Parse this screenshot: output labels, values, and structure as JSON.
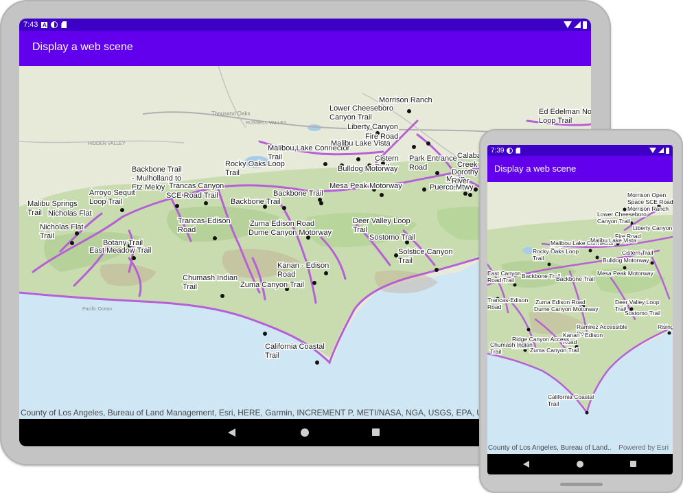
{
  "tablet": {
    "status": {
      "time": "7:43"
    },
    "app_title": "Display a web scene",
    "attribution": "County of Los Angeles, Bureau of Land Management, Esri, HERE, Garmin, INCREMENT P, METI/NASA, NGA, USGS, EPA, USDA",
    "trail_labels": [
      [
        "Morrison Ranch"
      ],
      [
        "Lower Cheeseboro",
        "Canyon Trail"
      ],
      [
        "Liberty Canyon"
      ],
      [
        "Fire Road"
      ],
      [
        "Malibou Lake Connector",
        "Trail"
      ],
      [
        "Malibu Lake Vista"
      ],
      [
        "Cistern",
        "Trail"
      ],
      [
        "Park Entrance",
        "Road"
      ],
      [
        "Bulldog Motorway"
      ],
      [
        "Ed Edelman No",
        "Loop Trail"
      ],
      [
        "Rocky Oaks Loop",
        "Trail"
      ],
      [
        "Backbone Trail",
        "- Mulholland to",
        "Etz Meloy"
      ],
      [
        "Trancas Canyon"
      ],
      [
        "SCE Road Trail"
      ],
      [
        "Arroyo Sequit",
        "Loop Trail"
      ],
      [
        "Backbone Trail"
      ],
      [
        "Backbone Trail"
      ],
      [
        "Mesa Peak Motorway"
      ],
      [
        "Malibu Springs",
        "Trail"
      ],
      [
        "Nicholas Flat"
      ],
      [
        "Nicholas Flat",
        "Trail"
      ],
      [
        "Trancas-Edison",
        "Road"
      ],
      [
        "Zuma Edison Road"
      ],
      [
        "Dume Canyon Motorway"
      ],
      [
        "Deer Valley Loop",
        "Trail"
      ],
      [
        "Sostomo Trail"
      ],
      [
        "Botany Trail"
      ],
      [
        "East Meadow Trail"
      ],
      [
        "Solstice Canyon",
        "Trail"
      ],
      [
        "Kanan - Edison",
        "Road"
      ],
      [
        "Chumash Indian",
        "Trail"
      ],
      [
        "Zuma Canyon Trail"
      ],
      [
        "California Coastal",
        "Trail"
      ],
      [
        "Calaba",
        "Creek"
      ],
      [
        "Moon",
        "Trail"
      ],
      [
        "Dorothy",
        "River"
      ],
      [
        "Puerco Mtwy"
      ]
    ],
    "geo_labels": [
      "Thousand Oaks",
      "HIDDEN VALLEY",
      "RUSSELL VALLEY",
      "Pacific Ocean"
    ]
  },
  "phone": {
    "status": {
      "time": "7:39"
    },
    "app_title": "Display a web scene",
    "attribution": "County of Los Angeles, Bureau of Land...",
    "powered_by": "Powered by Esri",
    "trail_labels": [
      [
        "Morrison Open",
        "Space SCE Road",
        "Morrison Ranch"
      ],
      [
        "Lower Cheeseboro",
        "Canyon Trail"
      ],
      [
        "Liberty Canyon"
      ],
      [
        "Fire Road"
      ],
      [
        "Malibou Lake Connector",
        "Trail"
      ],
      [
        "Malibu Lake Vista"
      ],
      [
        "Cistern Trail"
      ],
      [
        "Rocky Oaks Loop",
        "Trail"
      ],
      [
        "Bulldog Motorway"
      ],
      [
        "Backbone Trail"
      ],
      [
        "Backbone Trail"
      ],
      [
        "Mesa Peak Motorway"
      ],
      [
        "Zuma Edison Road"
      ],
      [
        "Dume Canyon Motorway"
      ],
      [
        "Deer Valley Loop",
        "Trail"
      ],
      [
        "Sostomo Trail"
      ],
      [
        "Ramirez Accessible",
        "Road"
      ],
      [
        "Kanan - Edison",
        "Road"
      ],
      [
        "Ridge Canyon Access",
        "Road"
      ],
      [
        "Chumash Indian",
        "Trail"
      ],
      [
        "Zuma Canyon Trail"
      ],
      [
        "Rising Sun Tr"
      ],
      [
        "California Coastal",
        "Trail"
      ],
      [
        "East Canyon",
        "Road Trail"
      ],
      [
        "Trancas-Edison",
        "Road"
      ]
    ]
  },
  "colors": {
    "status_bar": "#3c00c6",
    "app_bar": "#6200ee",
    "trail": "#b65fd6",
    "ocean": "#cfe6f5",
    "land": "#e7ead9",
    "vegetation": "#b8d69c"
  }
}
